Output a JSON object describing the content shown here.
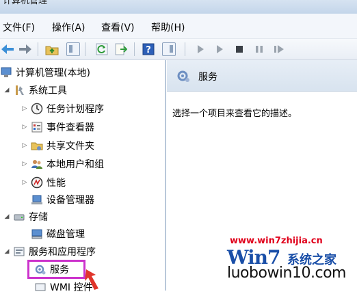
{
  "window": {
    "title": "计算机管理"
  },
  "menu": {
    "file": "文件(F)",
    "action": "操作(A)",
    "view": "查看(V)",
    "help": "帮助(H)"
  },
  "tree": {
    "root": "计算机管理(本地)",
    "system_tools": "系统工具",
    "task_scheduler": "任务计划程序",
    "event_viewer": "事件查看器",
    "shared_folders": "共享文件夹",
    "local_users": "本地用户和组",
    "performance": "性能",
    "device_manager": "设备管理器",
    "storage": "存储",
    "disk_management": "磁盘管理",
    "services_apps": "服务和应用程序",
    "services": "服务",
    "wmi": "WMI 控件"
  },
  "right_pane": {
    "title": "服务",
    "description": "选择一个项目来查看它的描述。"
  },
  "watermark": {
    "url": "www.win7zhijia.cn",
    "brand": "Win7",
    "brand_suffix": "系统之家",
    "domain": "luobowin10.com"
  },
  "colors": {
    "highlight_box": "#cc33cc",
    "watermark_red": "#e0001b",
    "watermark_blue": "#1a4fa8"
  }
}
